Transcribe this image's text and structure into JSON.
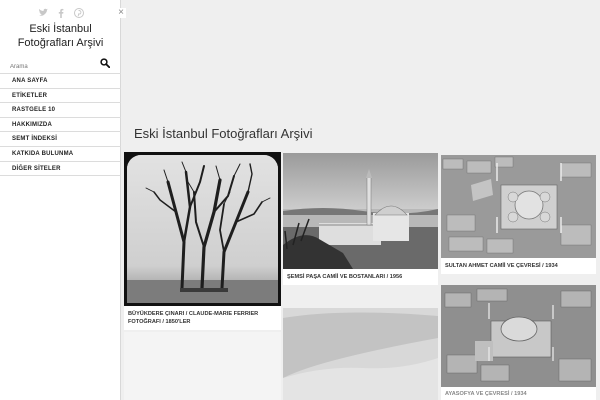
{
  "sidebar": {
    "title_line1": "Eski İstanbul",
    "title_line2": "Fotoğrafları Arşivi",
    "close_label": "×",
    "search_placeholder": "Arama",
    "menu": [
      {
        "label": "ANA SAYFA"
      },
      {
        "label": "ETİKETLER"
      },
      {
        "label": "RASTGELE 10"
      },
      {
        "label": "HAKKIMIZDA"
      },
      {
        "label": "SEMT İNDEKSİ"
      },
      {
        "label": "KATKIDA BULUNMA"
      },
      {
        "label": "DİĞER SİTELER"
      }
    ],
    "social_icons": [
      "twitter-icon",
      "facebook-icon",
      "pinterest-icon"
    ]
  },
  "main": {
    "heading": "Eski İstanbul Fotoğrafları Arşivi",
    "cards": [
      {
        "caption_line1": "BÜYÜKDERE ÇINARI / CLAUDE-MARIE FERRIER",
        "caption_line2": "FOTOĞRAFI / 1850'LER"
      },
      {
        "caption": "ŞEMSİ PAŞA CAMİİ VE BOSTANLARI / 1956"
      },
      {
        "caption": "SULTAN AHMET CAMİİ VE ÇEVRESİ / 1934"
      },
      {
        "caption": "AYASOFYA VE ÇEVRESİ / 1934"
      }
    ]
  },
  "colors": {
    "background": "#efefef",
    "sidebar": "#ffffff",
    "text": "#333333"
  }
}
